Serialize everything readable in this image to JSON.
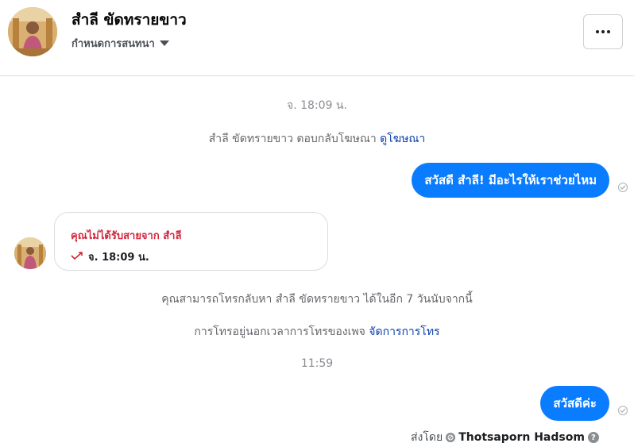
{
  "header": {
    "contact_name": "สำลี ขัดทรายขาว",
    "subtitle": "กำหนดการสนทนา",
    "more_icon": "more-horizontal-icon"
  },
  "messages": {
    "timestamp_1": "จ. 18:09 น.",
    "ad_reply_text": "สำลี ขัดทรายขาว ตอบกลับโฆษณา",
    "ad_reply_link": "ดูโฆษณา",
    "outgoing_1": "สวัสดี สำลี! มีอะไรให้เราช่วยไหม",
    "missed_call_title": "คุณไม่ได้รับสายจาก สำลี",
    "missed_call_time": "จ. 18:09 น.",
    "callback_notice": "คุณสามารถโทรกลับหา สำลี ขัดทรายขาว ได้ในอีก 7 วันนับจากนี้",
    "outside_hours_text": "การโทรอยู่นอกเวลาการโทรของเพจ",
    "manage_calls_link": "จัดการการโทร",
    "timestamp_2": "11:59",
    "outgoing_2": "สวัสดีค่ะ",
    "sent_by_label": "ส่งโดย",
    "sent_by_name": "Thotsaporn Hadsom"
  },
  "colors": {
    "outgoing_bubble": "#0a7cff",
    "missed_call_text": "#d2263b",
    "link": "#0a3ea8"
  }
}
